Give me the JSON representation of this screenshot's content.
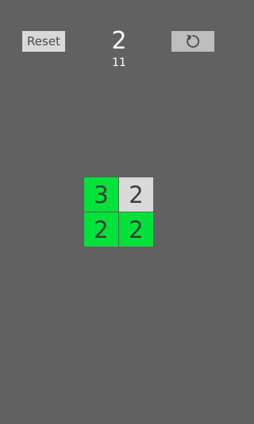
{
  "header": {
    "reset_label": "Reset",
    "level": "2",
    "moves": "11",
    "restart_icon": "restart-icon"
  },
  "board": {
    "rows": 2,
    "cols": 2,
    "tiles": [
      {
        "value": "3",
        "state": "active"
      },
      {
        "value": "2",
        "state": "inactive"
      },
      {
        "value": "2",
        "state": "active"
      },
      {
        "value": "2",
        "state": "active"
      }
    ]
  },
  "colors": {
    "background": "#616161",
    "tile_active": "#00e13a",
    "tile_inactive": "#d9d9d9",
    "button": "#d9d9d9",
    "text_light": "#ffffff",
    "text_dark": "#3d3d3d"
  }
}
